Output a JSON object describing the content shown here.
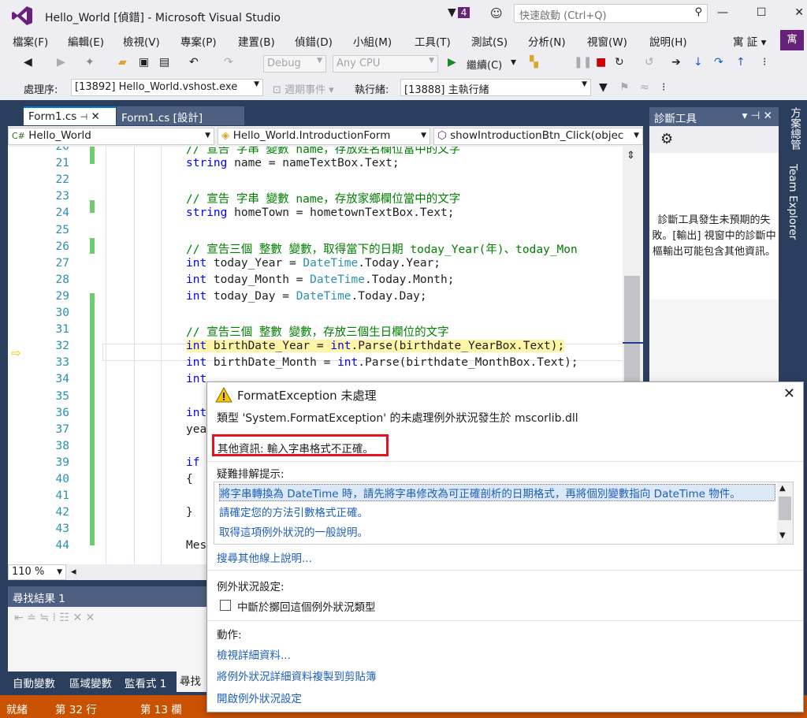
{
  "window": {
    "title": "Hello_World [偵錯] - Microsoft Visual Studio",
    "notification_count": "4",
    "quick_launch_placeholder": "快速啟動 (Ctrl+Q)"
  },
  "menu": [
    "檔案(F)",
    "編輯(E)",
    "檢視(V)",
    "專案(P)",
    "建置(B)",
    "偵錯(D)",
    "小組(M)",
    "工具(T)",
    "測試(S)",
    "分析(N)",
    "視窗(W)",
    "說明(H)"
  ],
  "account": {
    "name": "寓 証",
    "avatar": "寓"
  },
  "toolbar": {
    "config": "Debug",
    "platform": "Any CPU",
    "continue": "繼續(C)",
    "process_label": "處理序:",
    "process": "[13892] Hello_World.vshost.exe",
    "lifecycle": "週期事件",
    "thread_label": "執行緒:",
    "thread": "[13888] 主執行緒"
  },
  "editor": {
    "tabs": [
      {
        "label": "Form1.cs"
      },
      {
        "label": "Form1.cs [設計]"
      }
    ],
    "nav": {
      "project": "Hello_World",
      "class": "Hello_World.IntroductionForm",
      "member": "showIntroductionBtn_Click(objec"
    },
    "zoom": "110 %"
  },
  "code_lines": [
    {
      "num": "20",
      "text": "// 宣告 字串 變數 name，存放姓名欄位當中的文字"
    },
    {
      "num": "21",
      "kw": "string",
      "text": " name = nameTextBox.Text;"
    },
    {
      "num": "22",
      "text": ""
    },
    {
      "num": "23",
      "text": "// 宣告 字串 變數 name，存放家鄉欄位當中的文字"
    },
    {
      "num": "24",
      "kw": "string",
      "text": " homeTown = hometownTextBox.Text;"
    },
    {
      "num": "25",
      "text": ""
    },
    {
      "num": "26",
      "text": "// 宣告三個 整數 變數，取得當下的日期 today_Year(年)、today_Mon"
    },
    {
      "num": "27",
      "kw": "int",
      "text": " today_Year = ",
      "typ": "DateTime",
      "rest": ".Today.Year;"
    },
    {
      "num": "28",
      "kw": "int",
      "text": " today_Month = ",
      "typ": "DateTime",
      "rest": ".Today.Month;"
    },
    {
      "num": "29",
      "kw": "int",
      "text": " today_Day = ",
      "typ": "DateTime",
      "rest": ".Today.Day;"
    },
    {
      "num": "30",
      "text": ""
    },
    {
      "num": "31",
      "text": "// 宣告三個 整數 變數，存放三個生日欄位的文字"
    },
    {
      "num": "32",
      "kw": "int",
      "text": " birthDate_Year = ",
      "kw2": "int",
      "rest": ".Parse(birthdate_YearBox.Text);"
    },
    {
      "num": "33",
      "kw": "int",
      "text": " birthDate_Month = ",
      "kw2": "int",
      "rest": ".Parse(birthdate_MonthBox.Text);"
    },
    {
      "num": "34",
      "kw": "int",
      "text": ""
    },
    {
      "num": "35",
      "text": ""
    },
    {
      "num": "36",
      "kw": "int",
      "text": ""
    },
    {
      "num": "37",
      "text": "yea"
    },
    {
      "num": "38",
      "text": ""
    },
    {
      "num": "39",
      "kw": "if",
      "text": ""
    },
    {
      "num": "40",
      "text": "{"
    },
    {
      "num": "41",
      "text": ""
    },
    {
      "num": "42",
      "text": "}"
    },
    {
      "num": "43",
      "text": ""
    },
    {
      "num": "44",
      "text": "Mes"
    }
  ],
  "diagnostics": {
    "title": "診斷工具",
    "message": "診斷工具發生未預期的失敗。[輸出] 視窗中的診斷中樞輸出可能包含其他資訊。"
  },
  "side_tabs": [
    "方案總管",
    "Team Explorer"
  ],
  "find_panel": {
    "title": "尋找結果 1"
  },
  "bottom_tabs": [
    "自動變數",
    "區域變數",
    "監看式 1",
    "尋找結"
  ],
  "status": {
    "ready": "就緒",
    "line": "第 32 行",
    "col": "第 13 欄"
  },
  "exception": {
    "title": "FormatException 未處理",
    "type_text": "類型 'System.FormatException' 的未處理例外狀況發生於 mscorlib.dll",
    "extra": "其他資訊: 輸入字串格式不正確。",
    "hints_header": "疑難排解提示:",
    "hints": [
      "將字串轉換為 DateTime 時，請先將字串修改為可正確剖析的日期格式，再將個別變數指向 DateTime 物件。",
      "請確定您的方法引數格式正確。",
      "取得這項例外狀況的一般說明。"
    ],
    "search_online": "搜尋其他線上說明...",
    "settings_header": "例外狀況設定:",
    "break_checkbox": "中斷於擲回這個例外狀況類型",
    "actions_header": "動作:",
    "actions": [
      "檢視詳細資料...",
      "將例外狀況詳細資料複製到剪貼簿",
      "開啟例外狀況設定"
    ]
  }
}
